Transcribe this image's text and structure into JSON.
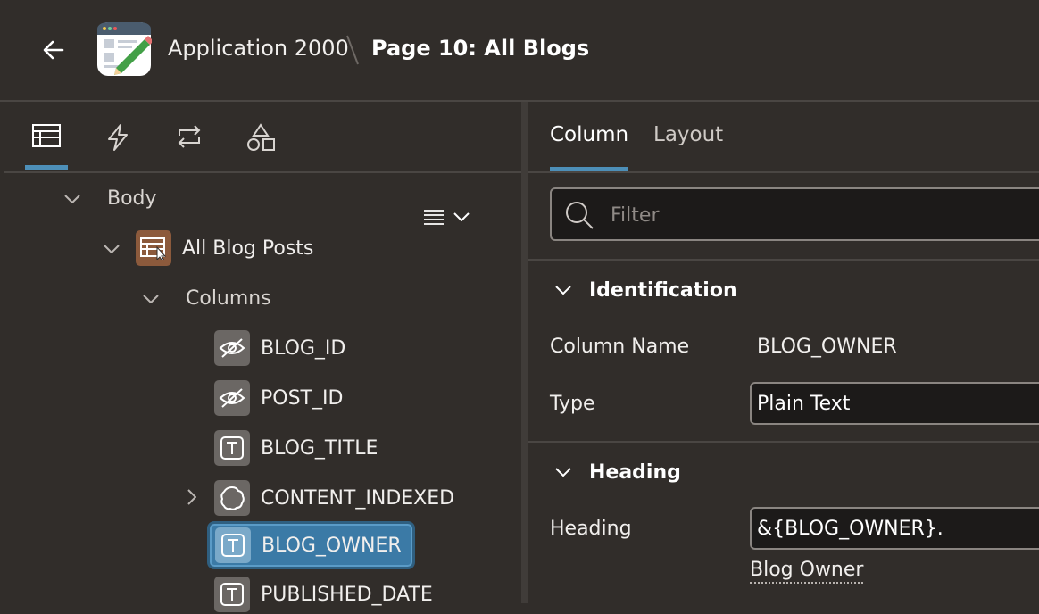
{
  "header": {
    "back_icon": "arrow-left-icon",
    "app_icon": "application-pencil-icon",
    "app_name": "Application 2000",
    "page_title": "Page 10: All Blogs"
  },
  "left_toolbar": {
    "items": [
      {
        "icon": "rendering-tree-icon",
        "active": true
      },
      {
        "icon": "dynamic-actions-icon",
        "active": false
      },
      {
        "icon": "processing-icon",
        "active": false
      },
      {
        "icon": "shared-components-icon",
        "active": false
      }
    ]
  },
  "tree": {
    "body": "Body",
    "region": "All Blog Posts",
    "columns_group": "Columns",
    "columns": [
      {
        "name": "BLOG_ID",
        "icon": "hidden-eye-icon"
      },
      {
        "name": "POST_ID",
        "icon": "hidden-eye-icon"
      },
      {
        "name": "BLOG_TITLE",
        "icon": "text-column-icon"
      },
      {
        "name": "CONTENT_INDEXED",
        "icon": "rich-text-icon"
      },
      {
        "name": "BLOG_OWNER",
        "icon": "text-column-icon",
        "selected": true
      },
      {
        "name": "PUBLISHED_DATE",
        "icon": "text-column-icon"
      }
    ]
  },
  "properties": {
    "tabs": [
      {
        "label": "Column",
        "active": true
      },
      {
        "label": "Layout",
        "active": false
      }
    ],
    "filter_placeholder": "Filter",
    "identification": {
      "title": "Identification",
      "column_name_label": "Column Name",
      "column_name_value": "BLOG_OWNER",
      "type_label": "Type",
      "type_value": "Plain Text"
    },
    "heading": {
      "title": "Heading",
      "heading_label": "Heading",
      "heading_value": "&{BLOG_OWNER}.",
      "heading_hint": "Blog Owner"
    }
  },
  "colors": {
    "background": "#312d2a",
    "accent": "#4d8fb8",
    "selected": "#3b7aa6",
    "region_icon": "#8c5a3c"
  }
}
